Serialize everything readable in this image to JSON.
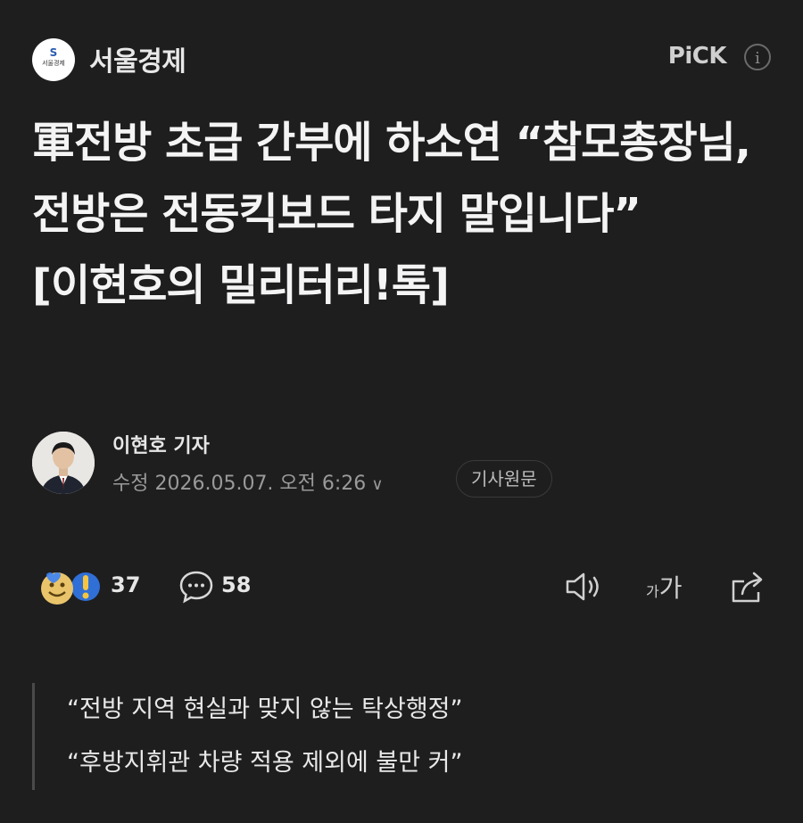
{
  "press": {
    "name": "서울경제",
    "logo_text": "서울경제",
    "pick_label": "PiCK",
    "info_icon": "info-icon"
  },
  "article": {
    "headline": "軍전방 초급 간부에 하소연 “참모총장님, 전방은 전동킥보드 타지 말입니다” [이현호의 밀리터리!톡]",
    "reporter": "이현호 기자",
    "date": "수정 2026.05.07. 오전 6:26",
    "original_button": "기사원문"
  },
  "actions": {
    "reaction_count": "37",
    "comment_count": "58",
    "font_size_small": "가",
    "font_size_large": "가",
    "icons": [
      "reaction-emoji-icon",
      "comment-bubble-icon",
      "speaker-icon",
      "font-size-icon",
      "share-icon"
    ]
  },
  "summary": [
    "“전방 지역 현실과 맞지 않는 탁상행정”",
    "“후방지휘관 차량 적용 제외에 불만 커”"
  ],
  "colors": {
    "background": "#1e1e1f",
    "text": "#f4f4f4",
    "muted": "#9a9a9a"
  }
}
